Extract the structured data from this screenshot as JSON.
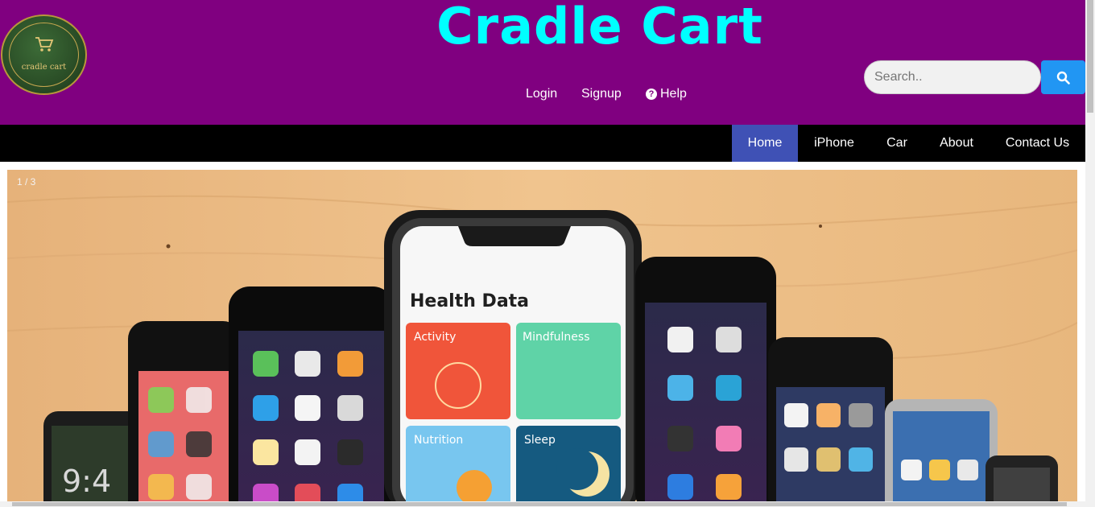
{
  "header": {
    "title": "Cradle Cart",
    "logo_text": "cradle cart",
    "links": {
      "login": "Login",
      "signup": "Signup",
      "help": "Help",
      "help_icon": "?"
    },
    "search": {
      "placeholder": "Search..",
      "value": ""
    }
  },
  "nav": {
    "items": [
      {
        "label": "Home",
        "active": true
      },
      {
        "label": "iPhone",
        "active": false
      },
      {
        "label": "Car",
        "active": false
      },
      {
        "label": "About",
        "active": false
      },
      {
        "label": "Contact Us",
        "active": false
      }
    ]
  },
  "slideshow": {
    "counter": "1 / 3",
    "screen_heading": "Health Data",
    "tiles": [
      "Activity",
      "Mindfulness",
      "Nutrition",
      "Sleep"
    ],
    "lock_time": "9:4"
  },
  "colors": {
    "header_bg": "#800080",
    "title": "#00ffff",
    "nav_bg": "#000000",
    "nav_active": "#3f51b5",
    "search_button": "#2196f3",
    "slide_bg": "#e8b97f"
  }
}
